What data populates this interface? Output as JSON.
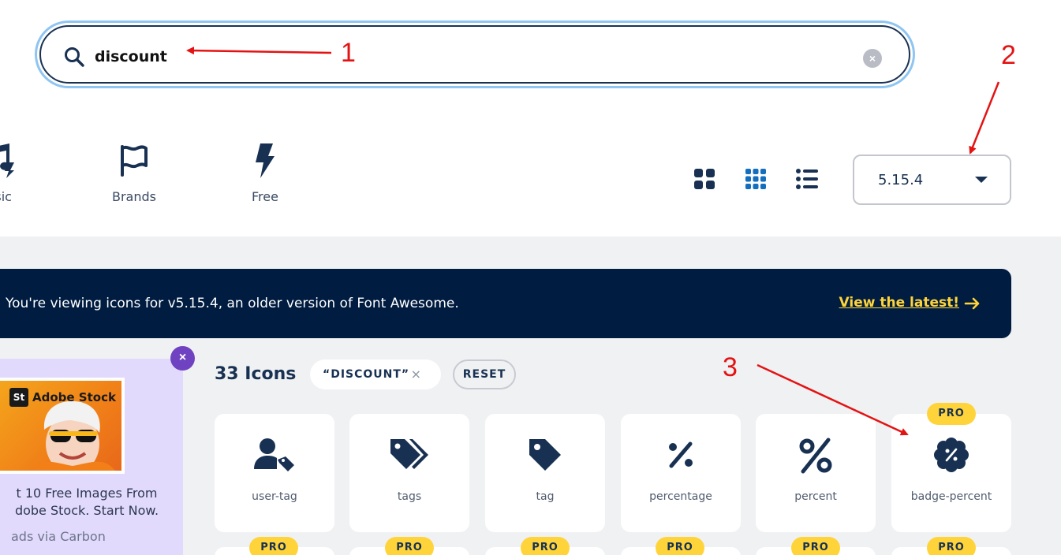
{
  "search": {
    "value": "discount",
    "clear_label": "×"
  },
  "styles": [
    {
      "label": "ssic",
      "icon": "music-icon"
    },
    {
      "label": "Brands",
      "icon": "flag-icon"
    },
    {
      "label": "Free",
      "icon": "bolt-icon"
    }
  ],
  "view_modes": [
    "large-grid-icon",
    "small-grid-icon",
    "list-icon"
  ],
  "version": {
    "selected": "5.15.4"
  },
  "notice": {
    "text": "You're viewing icons for v5.15.4, an older version of Font Awesome.",
    "link": "View the latest!"
  },
  "ad": {
    "brand": "Adobe Stock",
    "logo": "St",
    "copy_line1": "t 10 Free Images From",
    "copy_line2": "dobe Stock. Start Now.",
    "via": "ads via Carbon",
    "close": "×"
  },
  "results": {
    "count": "33 Icons",
    "filter_chip": "“DISCOUNT”",
    "filter_chip_close": "×",
    "reset": "RESET"
  },
  "cards": [
    {
      "label": "user-tag",
      "icon": "user-tag-icon",
      "pro": false
    },
    {
      "label": "tags",
      "icon": "tags-icon",
      "pro": false
    },
    {
      "label": "tag",
      "icon": "tag-icon",
      "pro": false
    },
    {
      "label": "percentage",
      "icon": "percentage-icon",
      "pro": false
    },
    {
      "label": "percent",
      "icon": "percent-icon",
      "pro": false
    },
    {
      "label": "badge-percent",
      "icon": "badge-percent-icon",
      "pro": true,
      "pro_label": "PRO"
    }
  ],
  "next_row_badges": [
    "PRO",
    "PRO",
    "PRO",
    "PRO",
    "PRO",
    "PRO"
  ],
  "annotations": [
    "1",
    "2",
    "3"
  ],
  "colors": {
    "navy": "#183153",
    "banner": "#001c40",
    "accent_yellow": "#ffd43b",
    "annotation_red": "#e41313",
    "active_view": "#146ebe"
  }
}
